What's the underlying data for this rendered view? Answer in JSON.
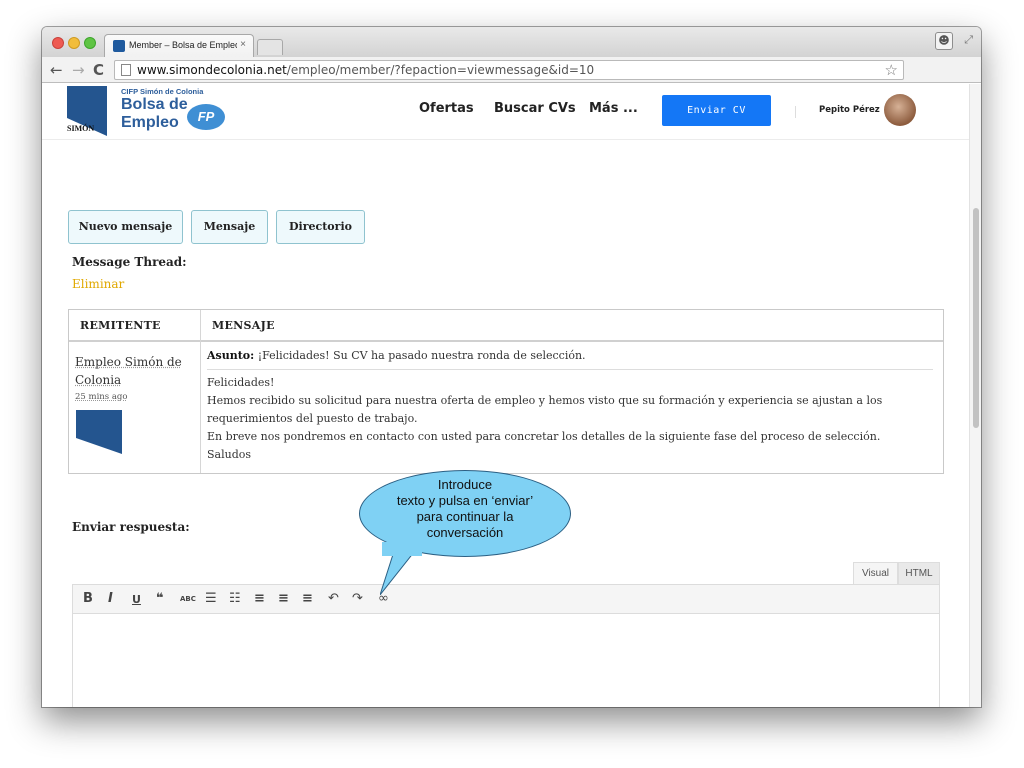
{
  "browser": {
    "tab_title": "Member – Bolsa de Empleo",
    "tab_close": "×",
    "url_domain": "www.simondecolonia.net",
    "url_path": "/empleo/member/?fepaction=viewmessage&id=10",
    "back_icon": "←",
    "forward_icon": "→",
    "reload_icon": "C",
    "star_icon": "☆",
    "menu_icon": "≡",
    "ext_icon": "!"
  },
  "site": {
    "logo_cifp": "CIFP Simón de Colonia",
    "logo_bolsa": "Bolsa de",
    "logo_empleo": "Empleo",
    "logo_fp": "FP",
    "logo_simon": "SIMÓN",
    "nav": [
      "Ofertas",
      "Buscar CVs",
      "Más ..."
    ],
    "cta": "Enviar CV",
    "user_name": "Pepito Pérez"
  },
  "messages": {
    "buttons": [
      "Nuevo mensaje",
      "Mensaje",
      "Directorio"
    ],
    "thread_label": "Message Thread:",
    "delete_label": "Eliminar",
    "columns": [
      "REMITENTE",
      "MENSAJE"
    ],
    "sender": {
      "name": "Empleo Simón de Colonia",
      "time": "25 mins ago"
    },
    "subject_label": "Asunto:",
    "subject": " ¡Felicidades! Su CV ha pasado nuestra ronda de selección.",
    "body": [
      "Felicidades!",
      "Hemos recibido su solicitud para nuestra oferta de empleo y hemos visto que su formación y experiencia se ajustan a los",
      "requerimientos del puesto de trabajo.",
      "En breve nos pondremos en contacto con usted para concretar los detalles de la siguiente fase del proceso de selección.",
      "Saludos"
    ]
  },
  "reply": {
    "label": "Enviar respuesta:",
    "tab_visual": "Visual",
    "tab_html": "HTML",
    "toolbar": [
      {
        "name": "bold",
        "glyph": "B"
      },
      {
        "name": "italic",
        "glyph": "I"
      },
      {
        "name": "underline",
        "glyph": "U"
      },
      {
        "name": "blockquote",
        "glyph": "❝"
      },
      {
        "name": "strikethrough",
        "glyph": "ABC"
      },
      {
        "name": "bullet-list",
        "glyph": "☰"
      },
      {
        "name": "numbered-list",
        "glyph": "☷"
      },
      {
        "name": "align-left",
        "glyph": "≡"
      },
      {
        "name": "align-center",
        "glyph": "≡"
      },
      {
        "name": "align-right",
        "glyph": "≡"
      },
      {
        "name": "undo",
        "glyph": "↶"
      },
      {
        "name": "redo",
        "glyph": "↷"
      },
      {
        "name": "link",
        "glyph": "∞"
      }
    ]
  },
  "annotation": {
    "lines": [
      "Introduce",
      "texto y pulsa en ‘enviar’",
      "para continuar la",
      "conversación"
    ],
    "fill": "#7fd1f4"
  }
}
